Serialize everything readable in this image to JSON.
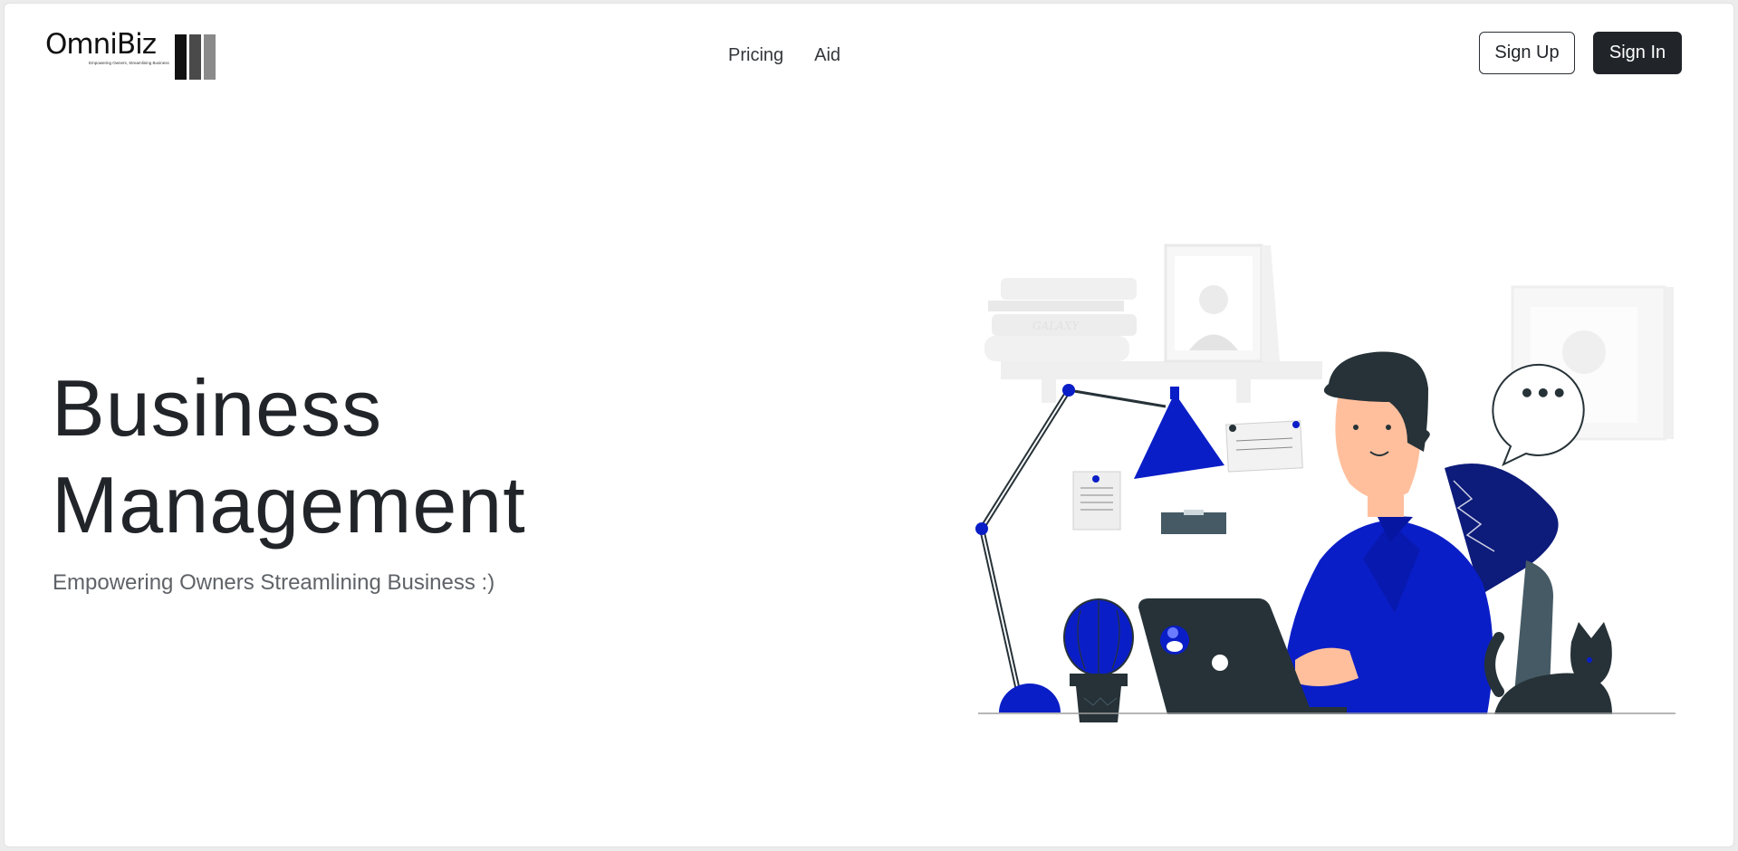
{
  "header": {
    "logo": {
      "name": "OmniBiz",
      "tagline": "Empowering Owners, Streamlining Business",
      "bar_colors": [
        "#121212",
        "#4a4a4a",
        "#8a8a8a"
      ]
    },
    "nav": [
      {
        "label": "Pricing"
      },
      {
        "label": "Aid"
      }
    ],
    "sign_up_label": "Sign Up",
    "sign_in_label": "Sign In"
  },
  "hero": {
    "title_line1": "Business",
    "title_line2": "Management",
    "subtitle": "Empowering Owners Streamlining Business :)",
    "illustration": {
      "book_label": "GALAXY",
      "speech_text": "•••"
    }
  },
  "colors": {
    "accent": "#0a1ec7",
    "dark": "#212529",
    "muted": "#5f6368"
  }
}
